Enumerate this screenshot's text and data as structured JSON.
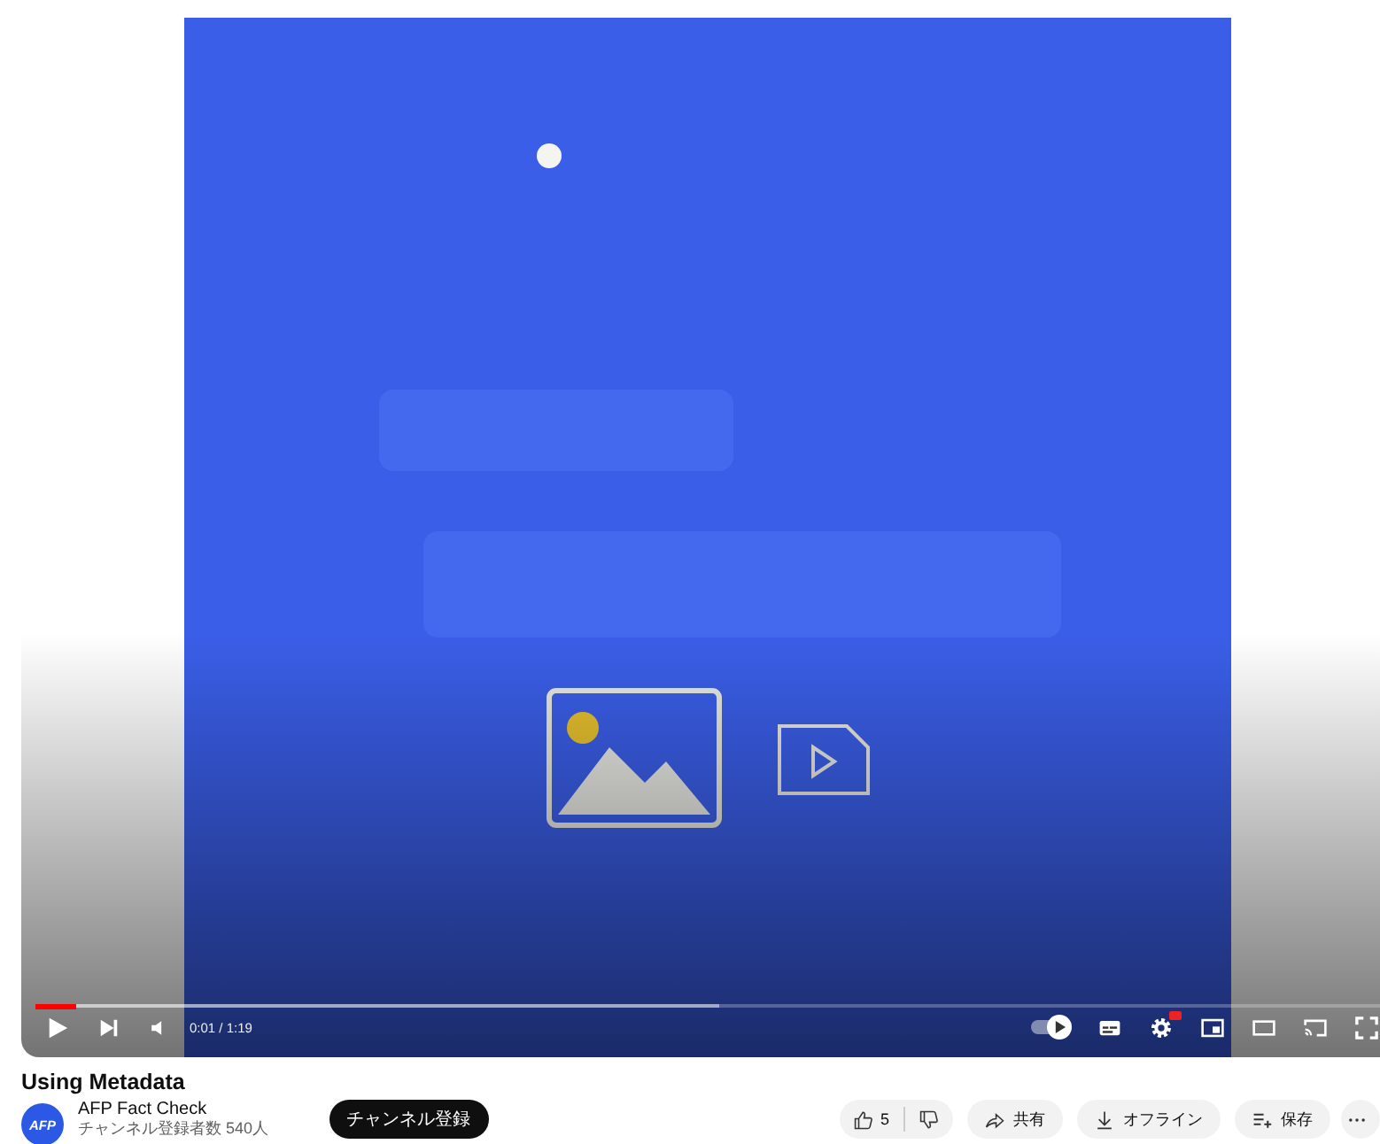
{
  "progress": {
    "level": 0.03
  },
  "buffer": {
    "level": 0.5
  },
  "time": "0:01 / 1:19",
  "autoplay": {
    "on": true
  },
  "settings": {
    "badge": true
  },
  "title": "Using Metadata",
  "channel": {
    "avatar": "AFP",
    "name": "AFP Fact Check",
    "subscribers": "チャンネル登録者数 540人"
  },
  "subscribe": "チャンネル登録",
  "likes": "5",
  "actions": [
    {
      "kind": "share",
      "label": "共有"
    },
    {
      "kind": "download",
      "label": "オフライン"
    },
    {
      "kind": "save",
      "label": "保存"
    }
  ]
}
